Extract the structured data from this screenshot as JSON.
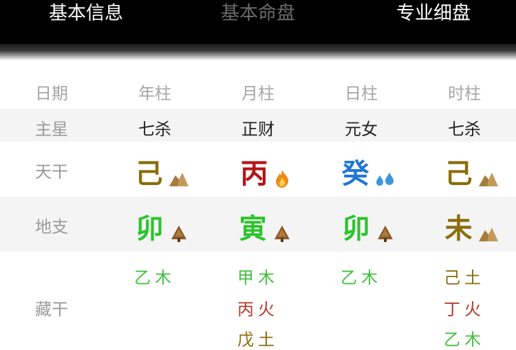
{
  "tabs": [
    "基本信息",
    "基本命盘",
    "专业细盘"
  ],
  "header": {
    "label": "日期",
    "columns": [
      "年柱",
      "月柱",
      "日柱",
      "时柱"
    ]
  },
  "rows": {
    "main_star": {
      "label": "主星",
      "values": [
        "七杀",
        "正财",
        "元女",
        "七杀"
      ]
    },
    "tiangan": {
      "label": "天干",
      "values": [
        {
          "char": "己",
          "element": "earth-icon",
          "color": "#8a6d0b"
        },
        {
          "char": "丙",
          "element": "fire-icon",
          "color": "#b3171a"
        },
        {
          "char": "癸",
          "element": "water-icon",
          "color": "#2176d3"
        },
        {
          "char": "己",
          "element": "earth-icon",
          "color": "#8a6d0b"
        }
      ]
    },
    "dizhi": {
      "label": "地支",
      "values": [
        {
          "char": "卯",
          "element": "wood-icon",
          "color": "#2cc32c"
        },
        {
          "char": "寅",
          "element": "wood-icon",
          "color": "#2cc32c"
        },
        {
          "char": "卯",
          "element": "wood-icon",
          "color": "#2cc32c"
        },
        {
          "char": "未",
          "element": "earth-icon",
          "color": "#8a6d0b"
        }
      ]
    },
    "canggan": {
      "label": "藏干",
      "columns": [
        [
          "乙木"
        ],
        [
          "甲木",
          "丙火",
          "戊土"
        ],
        [
          "乙木"
        ],
        [
          "己土",
          "丁火",
          "乙木"
        ]
      ]
    }
  },
  "colors": {
    "wood": "#3fbf3f",
    "fire": "#b53a2a",
    "earth": "#8a6d0b",
    "water": "#2176d3"
  }
}
